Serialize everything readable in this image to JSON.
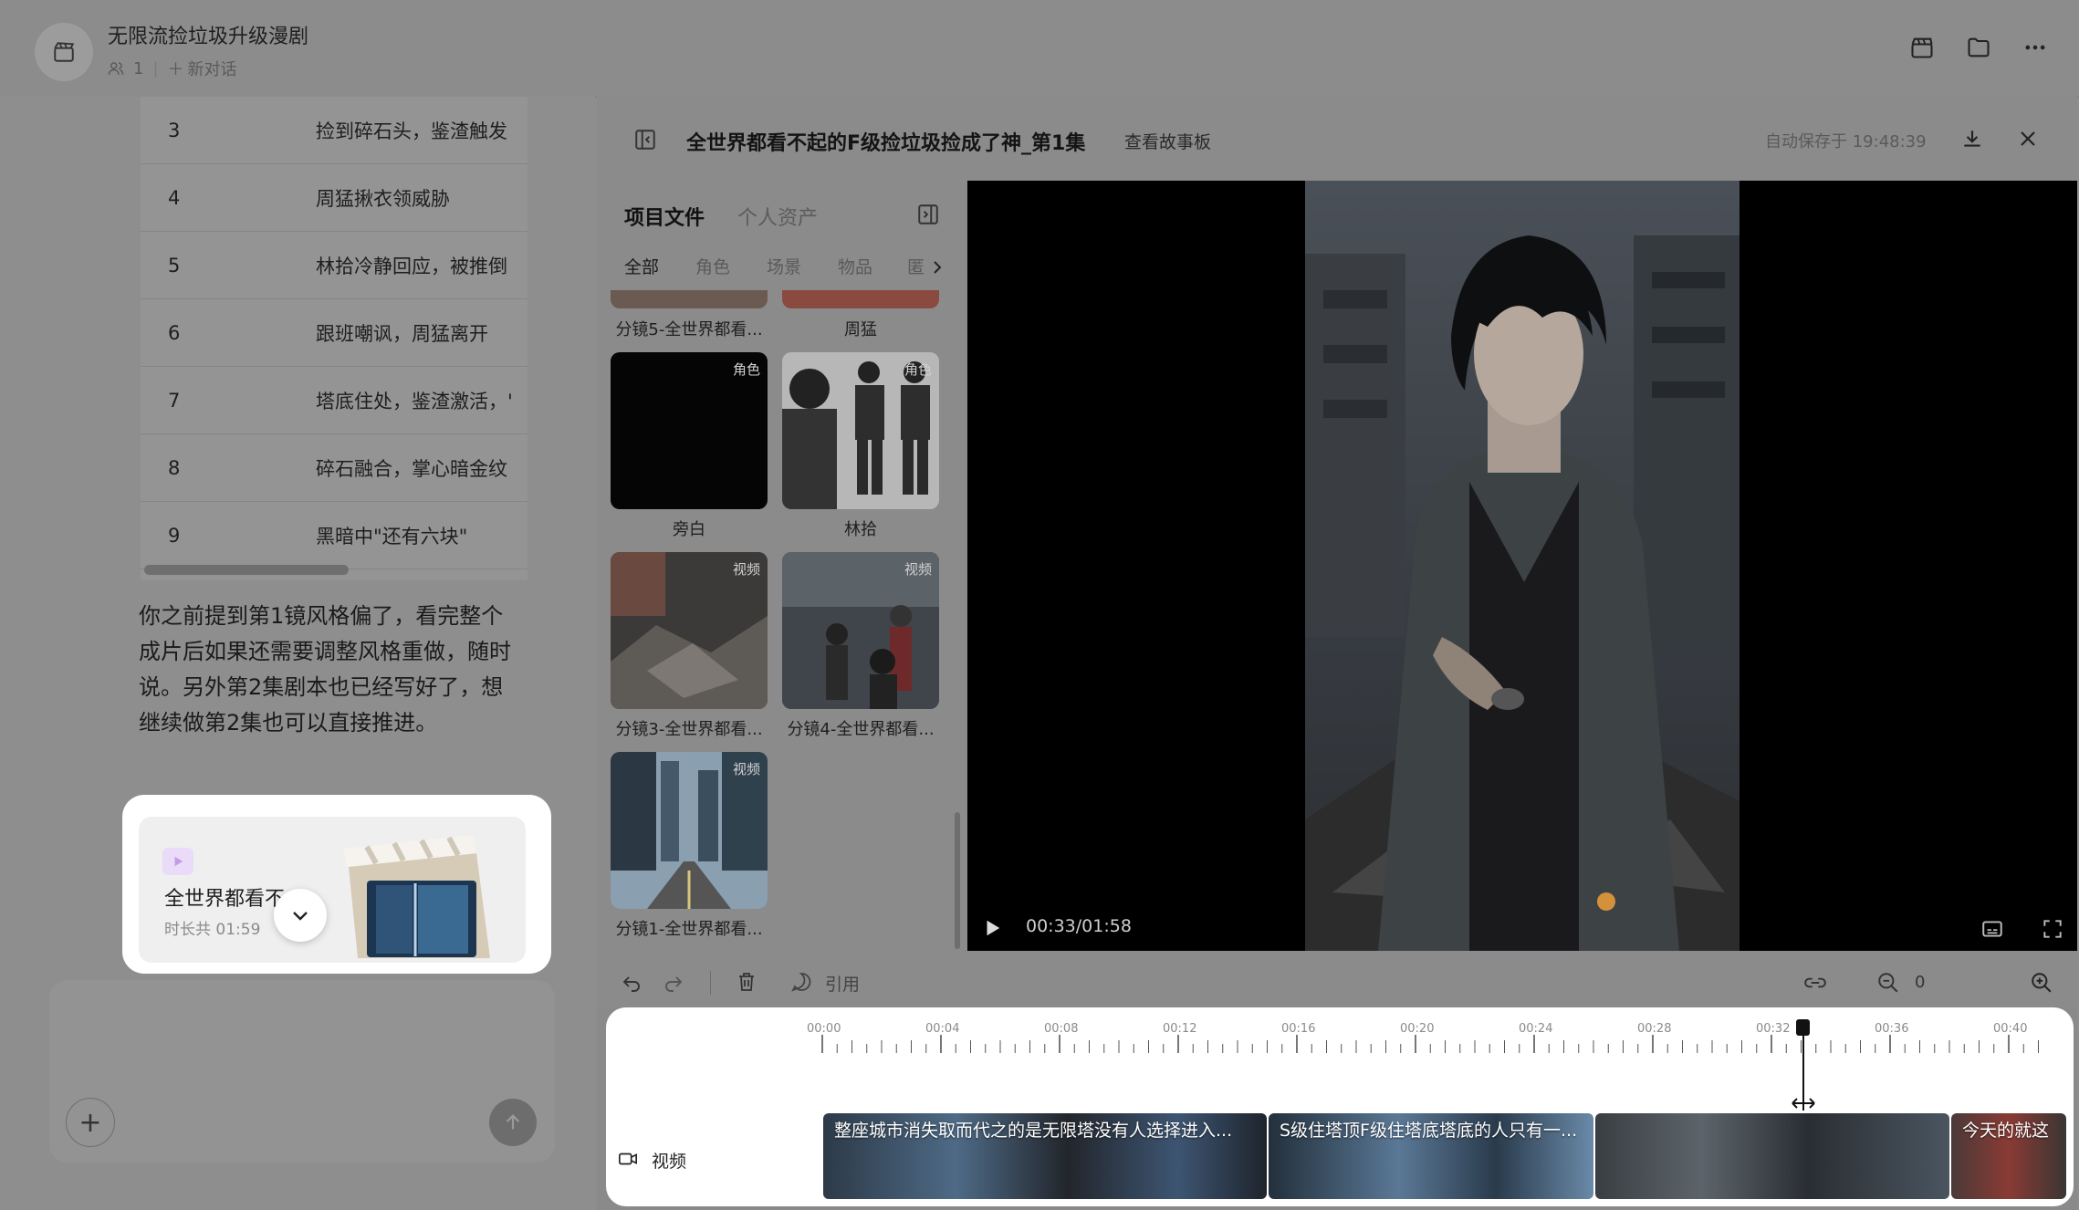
{
  "header": {
    "title": "无限流捡垃圾升级漫剧",
    "members": "1",
    "new_chat": "新对话"
  },
  "script_table": {
    "rows": [
      {
        "num": "3",
        "text": "捡到碎石头，鉴渣触发"
      },
      {
        "num": "4",
        "text": "周猛揪衣领威胁"
      },
      {
        "num": "5",
        "text": "林拾冷静回应，被推倒"
      },
      {
        "num": "6",
        "text": "跟班嘲讽，周猛离开"
      },
      {
        "num": "7",
        "text": "塔底住处，鉴渣激活，'"
      },
      {
        "num": "8",
        "text": "碎石融合，掌心暗金纹"
      },
      {
        "num": "9",
        "text": "黑暗中\"还有六块\""
      }
    ]
  },
  "chat": {
    "message": "你之前提到第1镜风格偏了，看完整个成片后如果还需要调整风格重做，随时说。另外第2集剧本也已经写好了，想继续做第2集也可以直接推进。",
    "card_title": "全世界都看不",
    "card_duration": "时长共 01:59"
  },
  "editor": {
    "title": "全世界都看不起的F级捡垃圾捡成了神_第1集",
    "storyboard_link": "查看故事板",
    "autosave": "自动保存于 19:48:39",
    "tabs": [
      "项目文件",
      "个人资产"
    ],
    "filters": [
      "全部",
      "角色",
      "场景",
      "物品",
      "匿"
    ],
    "assets": [
      {
        "label": "分镜5-全世界都看...",
        "badge": ""
      },
      {
        "label": "周猛",
        "badge": ""
      },
      {
        "label": "旁白",
        "badge": "角色"
      },
      {
        "label": "林拾",
        "badge": "角色"
      },
      {
        "label": "分镜3-全世界都看...",
        "badge": "视频"
      },
      {
        "label": "分镜4-全世界都看...",
        "badge": "视频"
      },
      {
        "label": "分镜1-全世界都看...",
        "badge": "视频"
      }
    ],
    "player_time": "00:33/01:58",
    "toolbar_ref": "引用",
    "zoom_value": "0"
  },
  "timeline": {
    "ticks": [
      "00:00",
      "00:04",
      "00:08",
      "00:12",
      "00:16",
      "00:20",
      "00:24",
      "00:28",
      "00:32",
      "00:36",
      "00:40"
    ],
    "track_label": "视频",
    "clips": [
      "整座城市消失取而代之的是无限塔没有人选择进入...",
      "S级住塔顶F级住塔底塔底的人只有一...",
      "",
      "今天的就这"
    ]
  }
}
